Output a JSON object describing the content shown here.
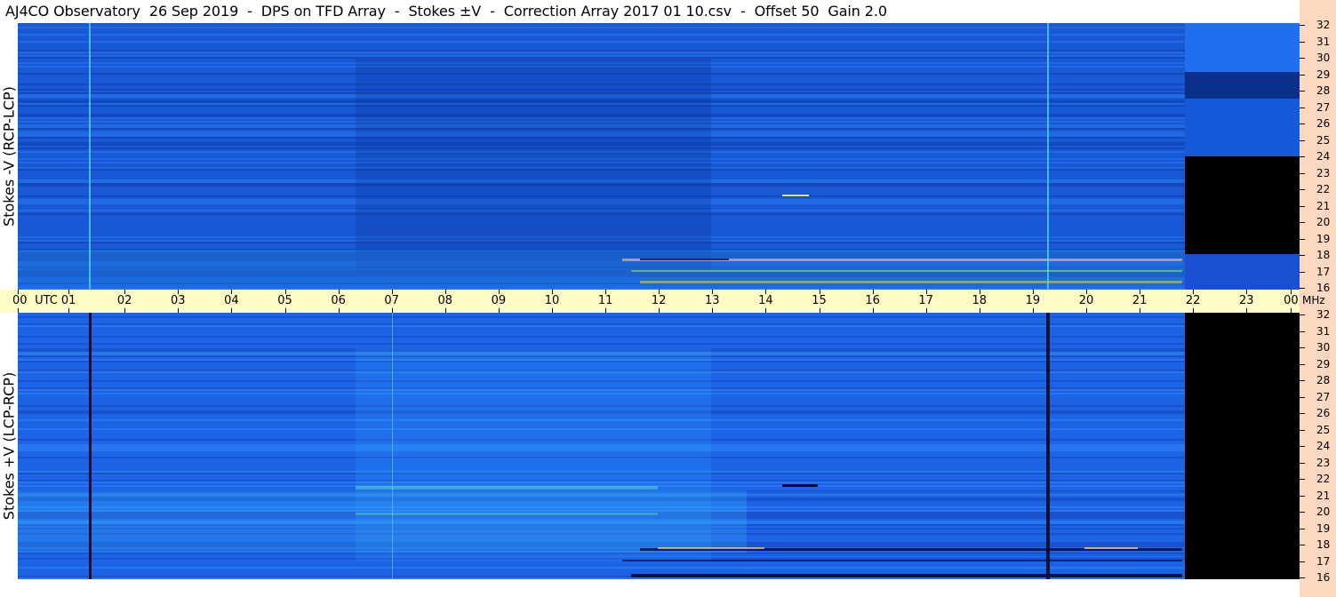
{
  "title": "AJ4CO Observatory  26 Sep 2019  -  DPS on TFD Array  -  Stokes ±V  -  Correction Array 2017 01 10.csv  -  Offset 50  Gain 2.0",
  "panels": [
    {
      "label": "Stokes -V (RCP-LCP)"
    },
    {
      "label": "Stokes +V (LCP-RCP)"
    }
  ],
  "time_axis": {
    "labels": [
      "00",
      "UTC",
      "01",
      "02",
      "03",
      "04",
      "05",
      "06",
      "07",
      "08",
      "09",
      "10",
      "11",
      "12",
      "13",
      "14",
      "15",
      "16",
      "17",
      "18",
      "19",
      "20",
      "21",
      "22",
      "23",
      "00"
    ],
    "unit": "MHz"
  },
  "freq_axis": {
    "labels": [
      "32",
      "31",
      "30",
      "29",
      "28",
      "27",
      "26",
      "25",
      "24",
      "23",
      "22",
      "21",
      "20",
      "19",
      "18",
      "17",
      "16"
    ]
  },
  "colors": {
    "background": "#1a56d6",
    "time_axis_bg": "#fefcc4",
    "freq_strip_bg": "#fbd8bf"
  }
}
